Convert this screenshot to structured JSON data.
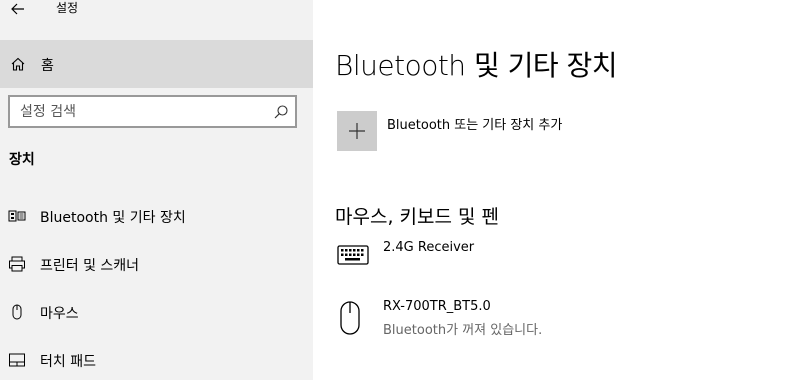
{
  "window": {
    "title": "설정",
    "back_icon": "back-arrow-icon"
  },
  "sidebar": {
    "home_label": "홈",
    "search": {
      "placeholder": "설정 검색",
      "value": ""
    },
    "section_heading": "장치",
    "items": [
      {
        "label": "Bluetooth 및 기타 장치",
        "icon": "bluetooth-devices-icon"
      },
      {
        "label": "프린터 및 스캐너",
        "icon": "printer-icon"
      },
      {
        "label": "마우스",
        "icon": "mouse-icon"
      },
      {
        "label": "터치 패드",
        "icon": "touchpad-icon"
      }
    ]
  },
  "main": {
    "title": "Bluetooth 및 기타 장치",
    "add_device_label": "Bluetooth 또는 기타 장치 추가",
    "section_title": "마우스, 키보드 및 펜",
    "devices": [
      {
        "name": "2.4G Receiver",
        "status": "",
        "icon": "keyboard-icon"
      },
      {
        "name": "RX-700TR_BT5.0",
        "status": "Bluetooth가 꺼져 있습니다.",
        "icon": "mouse-icon"
      }
    ]
  },
  "colors": {
    "sidebar_bg": "#f2f2f2",
    "selected_bg": "#dadada",
    "plus_tile": "#cccccc",
    "secondary_text": "#666666"
  }
}
